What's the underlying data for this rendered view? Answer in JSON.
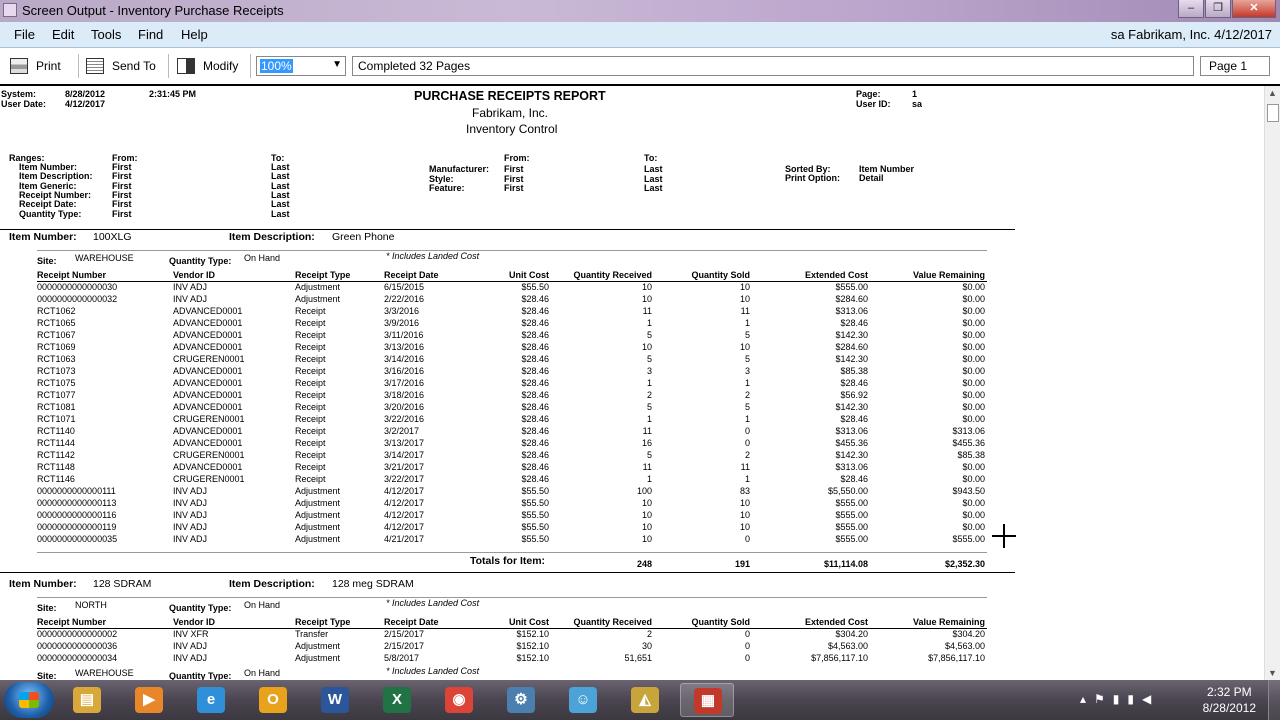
{
  "window": {
    "title": "Screen Output - Inventory Purchase Receipts",
    "controls": {
      "minimize": "–",
      "maximize": "❐",
      "close": "✕"
    }
  },
  "menu": {
    "items": [
      "File",
      "Edit",
      "Tools",
      "Find",
      "Help"
    ],
    "user_info": "sa  Fabrikam, Inc.  4/12/2017"
  },
  "toolbar": {
    "print": "Print",
    "send_to": "Send To",
    "modify": "Modify",
    "zoom": "100%",
    "status": "Completed 32 Pages",
    "page": "Page 1"
  },
  "report": {
    "system_label": "System:",
    "system_date": "8/28/2012",
    "system_time": "2:31:45 PM",
    "user_date_label": "User Date:",
    "user_date": "4/12/2017",
    "title": "PURCHASE RECEIPTS REPORT",
    "company": "Fabrikam, Inc.",
    "subtitle": "Inventory Control",
    "page_label": "Page:",
    "page_value": "1",
    "user_id_label": "User ID:",
    "user_id": "sa",
    "ranges_label": "Ranges:",
    "from_label": "From:",
    "to_label": "To:",
    "ranges_left": [
      {
        "label": "Item Number:",
        "from": "First",
        "to": "Last"
      },
      {
        "label": "Item Description:",
        "from": "First",
        "to": "Last"
      },
      {
        "label": "Item Generic:",
        "from": "First",
        "to": "Last"
      },
      {
        "label": "Receipt Number:",
        "from": "First",
        "to": "Last"
      },
      {
        "label": "Receipt Date:",
        "from": "First",
        "to": "Last"
      },
      {
        "label": "Quantity Type:",
        "from": "First",
        "to": "Last"
      }
    ],
    "ranges_mid": [
      {
        "label": "Manufacturer:",
        "from": "First",
        "to": "Last"
      },
      {
        "label": "Style:",
        "from": "First",
        "to": "Last"
      },
      {
        "label": "Feature:",
        "from": "First",
        "to": "Last"
      }
    ],
    "sorted_by_label": "Sorted By:",
    "sorted_by": "Item Number",
    "print_option_label": "Print Option:",
    "print_option": "Detail",
    "item_number_label": "Item Number:",
    "item_description_label": "Item Description:",
    "site_label": "Site:",
    "quantity_type_label": "Quantity Type:",
    "landed_cost_note": "*  Includes Landed Cost",
    "columns": [
      "Receipt Number",
      "Vendor ID",
      "Receipt Type",
      "Receipt Date",
      "Unit Cost",
      "Quantity Received",
      "Quantity Sold",
      "Extended Cost",
      "Value Remaining"
    ],
    "totals_label": "Totals for Item:",
    "items": [
      {
        "number": "100XLG",
        "description": "Green Phone",
        "site": "WAREHOUSE",
        "quantity_type": "On Hand",
        "rows": [
          [
            "0000000000000030",
            "INV ADJ",
            "Adjustment",
            "6/15/2015",
            "$55.50",
            "10",
            "10",
            "$555.00",
            "$0.00"
          ],
          [
            "0000000000000032",
            "INV ADJ",
            "Adjustment",
            "2/22/2016",
            "$28.46",
            "10",
            "10",
            "$284.60",
            "$0.00"
          ],
          [
            "RCT1062",
            "ADVANCED0001",
            "Receipt",
            "3/3/2016",
            "$28.46",
            "11",
            "11",
            "$313.06",
            "$0.00"
          ],
          [
            "RCT1065",
            "ADVANCED0001",
            "Receipt",
            "3/9/2016",
            "$28.46",
            "1",
            "1",
            "$28.46",
            "$0.00"
          ],
          [
            "RCT1067",
            "ADVANCED0001",
            "Receipt",
            "3/11/2016",
            "$28.46",
            "5",
            "5",
            "$142.30",
            "$0.00"
          ],
          [
            "RCT1069",
            "ADVANCED0001",
            "Receipt",
            "3/13/2016",
            "$28.46",
            "10",
            "10",
            "$284.60",
            "$0.00"
          ],
          [
            "RCT1063",
            "CRUGEREN0001",
            "Receipt",
            "3/14/2016",
            "$28.46",
            "5",
            "5",
            "$142.30",
            "$0.00"
          ],
          [
            "RCT1073",
            "ADVANCED0001",
            "Receipt",
            "3/16/2016",
            "$28.46",
            "3",
            "3",
            "$85.38",
            "$0.00"
          ],
          [
            "RCT1075",
            "ADVANCED0001",
            "Receipt",
            "3/17/2016",
            "$28.46",
            "1",
            "1",
            "$28.46",
            "$0.00"
          ],
          [
            "RCT1077",
            "ADVANCED0001",
            "Receipt",
            "3/18/2016",
            "$28.46",
            "2",
            "2",
            "$56.92",
            "$0.00"
          ],
          [
            "RCT1081",
            "ADVANCED0001",
            "Receipt",
            "3/20/2016",
            "$28.46",
            "5",
            "5",
            "$142.30",
            "$0.00"
          ],
          [
            "RCT1071",
            "CRUGEREN0001",
            "Receipt",
            "3/22/2016",
            "$28.46",
            "1",
            "1",
            "$28.46",
            "$0.00"
          ],
          [
            "RCT1140",
            "ADVANCED0001",
            "Receipt",
            "3/2/2017",
            "$28.46",
            "11",
            "0",
            "$313.06",
            "$313.06"
          ],
          [
            "RCT1144",
            "ADVANCED0001",
            "Receipt",
            "3/13/2017",
            "$28.46",
            "16",
            "0",
            "$455.36",
            "$455.36"
          ],
          [
            "RCT1142",
            "CRUGEREN0001",
            "Receipt",
            "3/14/2017",
            "$28.46",
            "5",
            "2",
            "$142.30",
            "$85.38"
          ],
          [
            "RCT1148",
            "ADVANCED0001",
            "Receipt",
            "3/21/2017",
            "$28.46",
            "11",
            "11",
            "$313.06",
            "$0.00"
          ],
          [
            "RCT1146",
            "CRUGEREN0001",
            "Receipt",
            "3/22/2017",
            "$28.46",
            "1",
            "1",
            "$28.46",
            "$0.00"
          ],
          [
            "0000000000000111",
            "INV ADJ",
            "Adjustment",
            "4/12/2017",
            "$55.50",
            "100",
            "83",
            "$5,550.00",
            "$943.50"
          ],
          [
            "0000000000000113",
            "INV ADJ",
            "Adjustment",
            "4/12/2017",
            "$55.50",
            "10",
            "10",
            "$555.00",
            "$0.00"
          ],
          [
            "0000000000000116",
            "INV ADJ",
            "Adjustment",
            "4/12/2017",
            "$55.50",
            "10",
            "10",
            "$555.00",
            "$0.00"
          ],
          [
            "0000000000000119",
            "INV ADJ",
            "Adjustment",
            "4/12/2017",
            "$55.50",
            "10",
            "10",
            "$555.00",
            "$0.00"
          ],
          [
            "0000000000000035",
            "INV ADJ",
            "Adjustment",
            "4/21/2017",
            "$55.50",
            "10",
            "0",
            "$555.00",
            "$555.00"
          ]
        ],
        "totals": {
          "received": "248",
          "sold": "191",
          "extended": "$11,114.08",
          "remaining": "$2,352.30"
        }
      },
      {
        "number": "128 SDRAM",
        "description": "128 meg SDRAM",
        "site": "NORTH",
        "quantity_type": "On Hand",
        "rows": [
          [
            "0000000000000002",
            "INV XFR",
            "Transfer",
            "2/15/2017",
            "$152.10",
            "2",
            "0",
            "$304.20",
            "$304.20"
          ],
          [
            "0000000000000036",
            "INV ADJ",
            "Adjustment",
            "2/15/2017",
            "$152.10",
            "30",
            "0",
            "$4,563.00",
            "$4,563.00"
          ],
          [
            "0000000000000034",
            "INV ADJ",
            "Adjustment",
            "5/8/2017",
            "$152.10",
            "51,651",
            "0",
            "$7,856,117.10",
            "$7,856,117.10"
          ]
        ],
        "next_site": "WAREHOUSE",
        "next_quantity_type": "On Hand"
      }
    ]
  },
  "taskbar": {
    "apps": [
      {
        "name": "file-explorer",
        "glyph": "▤",
        "color": "#d9a83a"
      },
      {
        "name": "media-player",
        "glyph": "▶",
        "color": "#e8862a"
      },
      {
        "name": "internet-explorer",
        "glyph": "e",
        "color": "#2f8fd8"
      },
      {
        "name": "outlook",
        "glyph": "O",
        "color": "#e8a21c"
      },
      {
        "name": "word",
        "glyph": "W",
        "color": "#2b579a"
      },
      {
        "name": "excel",
        "glyph": "X",
        "color": "#217346"
      },
      {
        "name": "chrome",
        "glyph": "◉",
        "color": "#db4437"
      },
      {
        "name": "settings",
        "glyph": "⚙",
        "color": "#4a7fb0"
      },
      {
        "name": "lync",
        "glyph": "☺",
        "color": "#4ba3d8"
      },
      {
        "name": "dynamics-gp",
        "glyph": "◭",
        "color": "#c7a53a"
      },
      {
        "name": "screen-output",
        "glyph": "▦",
        "color": "#c0392b"
      }
    ],
    "time": "2:32 PM",
    "date": "8/28/2012"
  }
}
